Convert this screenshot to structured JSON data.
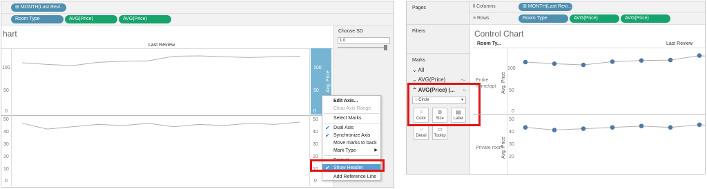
{
  "left": {
    "columns_pill": "MONTH(Last Revi...",
    "rows_pills": [
      "Room Type",
      "AVG(Price)",
      "AVG(Price)"
    ],
    "title_fragment": "hart",
    "header_label": "Last Review",
    "top_axis_ticks": [
      "100",
      "50",
      "0"
    ],
    "bottom_axis_ticks": [
      "50",
      "40",
      "30",
      "20",
      "10",
      "0"
    ],
    "right_axis_top_ticks": [
      "100",
      "50",
      "0"
    ],
    "right_axis_bottom_ticks": [
      "50",
      "40",
      "30",
      "20",
      "10",
      "0"
    ],
    "axis_title": "Avg. Price",
    "parameter": {
      "title": "Choose SD",
      "value": "1.0"
    },
    "context_menu": {
      "items": [
        {
          "label": "Edit Axis...",
          "state": "bold"
        },
        {
          "label": "Clear Axis Range",
          "state": "disabled"
        },
        {
          "label": "Select Marks",
          "state": "normal"
        },
        {
          "label": "Dual Axis",
          "state": "checked"
        },
        {
          "label": "Synchronize Axis",
          "state": "checked"
        },
        {
          "label": "Move marks to back",
          "state": "normal"
        },
        {
          "label": "Mark Type",
          "state": "submenu"
        },
        {
          "label": "Format...",
          "state": "normal"
        },
        {
          "label": "Show Header",
          "state": "highlighted"
        },
        {
          "label": "Add Reference Line",
          "state": "normal"
        }
      ]
    }
  },
  "right": {
    "pages_label": "Pages",
    "columns_label": "Columns",
    "rows_label": "Rows",
    "columns_pill": "MONTH(Last Revi...",
    "rows_pills": [
      "Room Type",
      "AVG(Price)",
      "AVG(Price)"
    ],
    "filters_label": "Filters",
    "marks": {
      "title": "Marks",
      "all_label": "All",
      "avg1_label": "AVG(Price)",
      "avg2_label": "AVG(Price) (...",
      "mark_type": "Circle",
      "buttons": [
        "Color",
        "Size",
        "Label",
        "Detail",
        "Tooltip"
      ]
    },
    "chart_title": "Control Chart",
    "row_header": "Room Ty...",
    "col_header": "Last Review",
    "row_labels": [
      "Entire home/apt",
      "Private room"
    ],
    "top_axis_ticks": [
      "100",
      "50",
      "0"
    ],
    "bottom_axis_ticks": [
      "50",
      "40",
      "30",
      "20"
    ],
    "axis_title": "Avg. Price"
  },
  "chart_data": [
    {
      "type": "line",
      "title": "",
      "xlabel": "Last Review",
      "ylabel": "Avg. Price",
      "series": [
        {
          "values": [
            121,
            117,
            114,
            122,
            125,
            126,
            137,
            138,
            136,
            134,
            136,
            137
          ]
        }
      ],
      "ylim": [
        0,
        150
      ]
    },
    {
      "type": "line",
      "title": "",
      "xlabel": "Last Review",
      "ylabel": "Avg. Price",
      "series": [
        {
          "values": [
            51,
            46,
            48,
            50,
            49,
            51,
            48,
            50,
            49,
            51,
            50,
            52
          ]
        }
      ],
      "ylim": [
        0,
        55
      ]
    },
    {
      "type": "scatter",
      "title": "Control Chart",
      "xlabel": "Last Review",
      "ylabel": "Avg. Price",
      "series": [
        {
          "name": "Entire home/apt",
          "values": [
            121,
            117,
            114,
            122,
            125,
            126,
            137
          ]
        },
        {
          "name": "Private room",
          "values": [
            48,
            46,
            47,
            48,
            49,
            48,
            50
          ]
        }
      ]
    }
  ]
}
